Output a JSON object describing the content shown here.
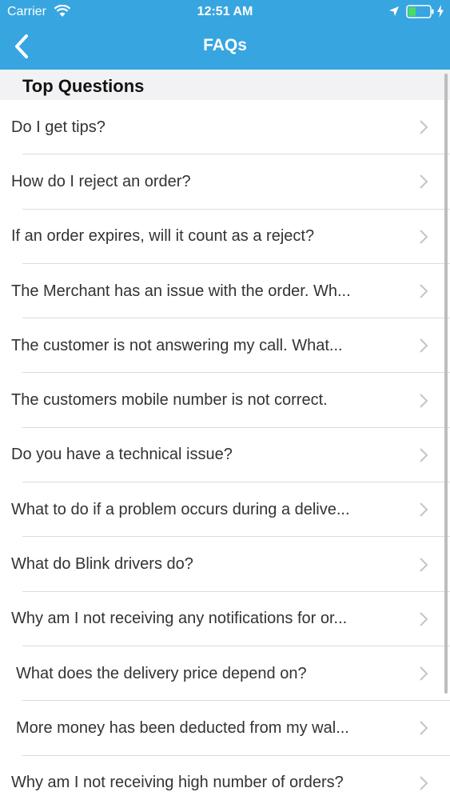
{
  "status_bar": {
    "carrier": "Carrier",
    "time": "12:51 AM",
    "battery_level": 0.35,
    "battery_color": "#4cd964"
  },
  "nav_bar": {
    "title": "FAQs",
    "back_icon": "chevron-left-icon",
    "background_color": "#37a5e0"
  },
  "section": {
    "title": "Top Questions"
  },
  "faqs": [
    {
      "label": "Do I get tips?"
    },
    {
      "label": "How do I reject an order?"
    },
    {
      "label": "If an order expires, will it count as a reject?"
    },
    {
      "label": "The Merchant has an issue with the order. Wh..."
    },
    {
      "label": "The customer is not answering my call. What..."
    },
    {
      "label": "The customers mobile number is not correct."
    },
    {
      "label": "Do you have a technical issue?"
    },
    {
      "label": "What to do if a problem occurs during a delive..."
    },
    {
      "label": "What do Blink drivers do?"
    },
    {
      "label": "Why am I not receiving any notifications for or..."
    },
    {
      "label": "What does the delivery price depend on?"
    },
    {
      "label": "More money has been deducted from my wal..."
    },
    {
      "label": "Why am I not receiving high number of orders?"
    }
  ]
}
